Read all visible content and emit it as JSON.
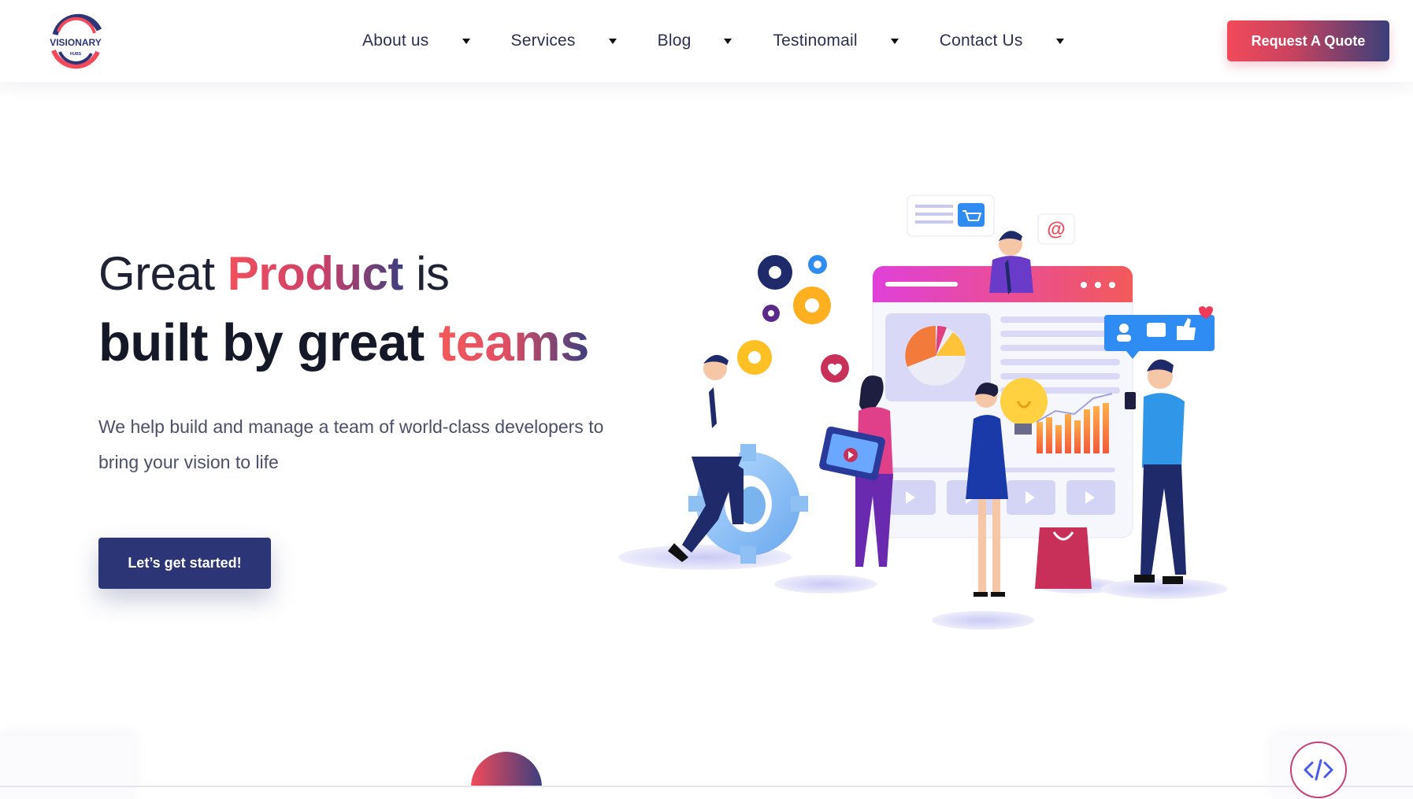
{
  "brand": {
    "logo_text": "VISIONARY",
    "logo_subtext": "HUBS"
  },
  "nav": {
    "items": [
      {
        "label": "About us"
      },
      {
        "label": "Services"
      },
      {
        "label": "Blog"
      },
      {
        "label": "Testinomail"
      },
      {
        "label": "Contact Us"
      }
    ],
    "cta_label": "Request A Quote"
  },
  "hero": {
    "line1_pre": "Great ",
    "line1_highlight": "Product",
    "line1_post": " is",
    "line2_pre": "built by great ",
    "line2_highlight": "teams",
    "description": "We help build and manage a team of world-class developers to bring your vision to life",
    "cta_label": "Let’s get started!"
  },
  "colors": {
    "accent_red": "#f24a5a",
    "accent_navy": "#2c3575",
    "gradient_end": "#3c3f7e"
  },
  "icons": [
    "logo-emblem",
    "caret-down-icon",
    "code-icon",
    "illustration-team"
  ]
}
